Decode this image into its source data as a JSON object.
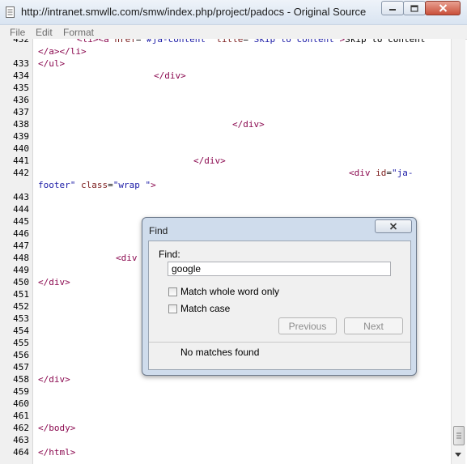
{
  "window": {
    "title": "http://intranet.smwllc.com/smw/index.php/project/padocs - Original Source",
    "icons": {
      "app": "document-icon",
      "minimize": "minimize-icon",
      "maximize": "maximize-icon",
      "close": "close-icon"
    }
  },
  "menu": {
    "items": [
      "File",
      "Edit",
      "Format"
    ]
  },
  "editor": {
    "lines": [
      {
        "n": "432",
        "segs": [
          {
            "c": "tag",
            "t": "<li><a "
          },
          {
            "c": "attr",
            "t": "href"
          },
          {
            "c": "txt",
            "t": "="
          },
          {
            "c": "val",
            "t": "\"#ja-content\""
          },
          {
            "c": "txt",
            "t": " "
          },
          {
            "c": "attr",
            "t": "title"
          },
          {
            "c": "txt",
            "t": "="
          },
          {
            "c": "val",
            "t": "\"Skip to content\""
          },
          {
            "c": "tag",
            "t": ">"
          },
          {
            "c": "txt",
            "t": "Skip to content"
          }
        ],
        "indent": 48
      },
      {
        "n": "",
        "segs": [
          {
            "c": "tag",
            "t": "</a></li>"
          }
        ],
        "indent": 0
      },
      {
        "n": "433",
        "segs": [
          {
            "c": "tag",
            "t": "</ul>"
          }
        ],
        "indent": 0
      },
      {
        "n": "434",
        "segs": [
          {
            "c": "tag",
            "t": "</div>"
          }
        ],
        "indent": 143
      },
      {
        "n": "435",
        "segs": [],
        "indent": 0
      },
      {
        "n": "436",
        "segs": [],
        "indent": 0
      },
      {
        "n": "437",
        "segs": [],
        "indent": 0
      },
      {
        "n": "438",
        "segs": [
          {
            "c": "tag",
            "t": "</div>"
          }
        ],
        "indent": 240
      },
      {
        "n": "439",
        "segs": [],
        "indent": 0
      },
      {
        "n": "440",
        "segs": [],
        "indent": 0
      },
      {
        "n": "441",
        "segs": [
          {
            "c": "tag",
            "t": "</div>"
          }
        ],
        "indent": 192
      },
      {
        "n": "442",
        "segs": [
          {
            "c": "tag",
            "t": "<div "
          },
          {
            "c": "attr",
            "t": "id"
          },
          {
            "c": "txt",
            "t": "="
          },
          {
            "c": "val",
            "t": "\"ja-"
          }
        ],
        "indent": 384
      },
      {
        "n": "",
        "segs": [
          {
            "c": "val",
            "t": "footer\""
          },
          {
            "c": "txt",
            "t": " "
          },
          {
            "c": "attr",
            "t": "class"
          },
          {
            "c": "txt",
            "t": "="
          },
          {
            "c": "val",
            "t": "\"wrap \""
          },
          {
            "c": "tag",
            "t": ">"
          }
        ],
        "indent": 0
      },
      {
        "n": "443",
        "segs": [],
        "indent": 0
      },
      {
        "n": "444",
        "segs": [],
        "indent": 0
      },
      {
        "n": "445",
        "segs": [],
        "indent": 0
      },
      {
        "n": "446",
        "segs": [],
        "indent": 0
      },
      {
        "n": "447",
        "segs": [],
        "indent": 0
      },
      {
        "n": "448",
        "segs": [
          {
            "c": "tag",
            "t": "<div"
          }
        ],
        "indent": 96
      },
      {
        "n": "449",
        "segs": [],
        "indent": 0
      },
      {
        "n": "450",
        "segs": [
          {
            "c": "tag",
            "t": "</div>"
          }
        ],
        "indent": 0
      },
      {
        "n": "451",
        "segs": [],
        "indent": 0
      },
      {
        "n": "452",
        "segs": [],
        "indent": 0
      },
      {
        "n": "453",
        "segs": [],
        "indent": 0
      },
      {
        "n": "454",
        "segs": [],
        "indent": 0
      },
      {
        "n": "455",
        "segs": [],
        "indent": 0
      },
      {
        "n": "456",
        "segs": [],
        "indent": 0
      },
      {
        "n": "457",
        "segs": [],
        "indent": 0
      },
      {
        "n": "458",
        "segs": [
          {
            "c": "tag",
            "t": "</div>"
          }
        ],
        "indent": 0
      },
      {
        "n": "459",
        "segs": [],
        "indent": 0
      },
      {
        "n": "460",
        "segs": [],
        "indent": 0
      },
      {
        "n": "461",
        "segs": [],
        "indent": 0
      },
      {
        "n": "462",
        "segs": [
          {
            "c": "tag",
            "t": "</body>"
          }
        ],
        "indent": 0
      },
      {
        "n": "463",
        "segs": [],
        "indent": 0
      },
      {
        "n": "464",
        "segs": [
          {
            "c": "tag",
            "t": "</html>"
          }
        ],
        "indent": 0
      }
    ]
  },
  "find_dialog": {
    "title": "Find",
    "find_label": "Find:",
    "query": "google",
    "match_whole_word_label": "Match whole word only",
    "match_whole_word_checked": false,
    "match_case_label": "Match case",
    "match_case_checked": false,
    "previous_label": "Previous",
    "next_label": "Next",
    "status": "No matches found",
    "close_icon": "close-icon"
  },
  "colors": {
    "tag": "#8b0a50",
    "attribute": "#7a1a1a",
    "value": "#1a1aa6",
    "dialog_frame": "#cfdcec"
  }
}
